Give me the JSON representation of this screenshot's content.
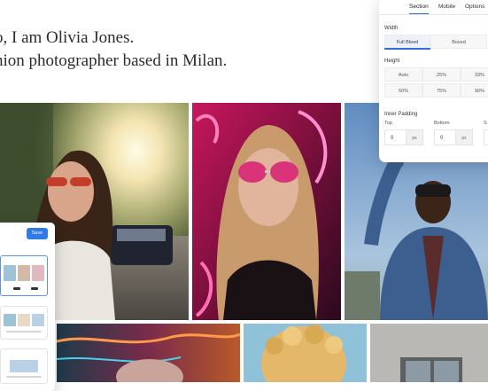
{
  "hero": {
    "line1": "o, I am Olivia Jones.",
    "line2": "hion photographer based in Milan."
  },
  "settings": {
    "tabs": [
      "Section",
      "Mobile",
      "Options"
    ],
    "active_tab": "Section",
    "width": {
      "label": "Width",
      "options": [
        "Full Bleed",
        "Boxed"
      ],
      "selected": "Full Bleed"
    },
    "height": {
      "label": "Height",
      "options": [
        "Auto",
        "25%",
        "33%",
        "50%",
        "75%",
        "90%"
      ]
    },
    "inner_padding": {
      "label": "Inner Padding",
      "fields": [
        {
          "label": "Top",
          "value": "0",
          "unit": "px"
        },
        {
          "label": "Bottom",
          "value": "0",
          "unit": "px"
        },
        {
          "label": "S",
          "value": "",
          "unit": ""
        }
      ]
    },
    "accent": "#2f6fd6"
  },
  "picker": {
    "save_label": "Save",
    "accent": "#2f7ae5"
  }
}
